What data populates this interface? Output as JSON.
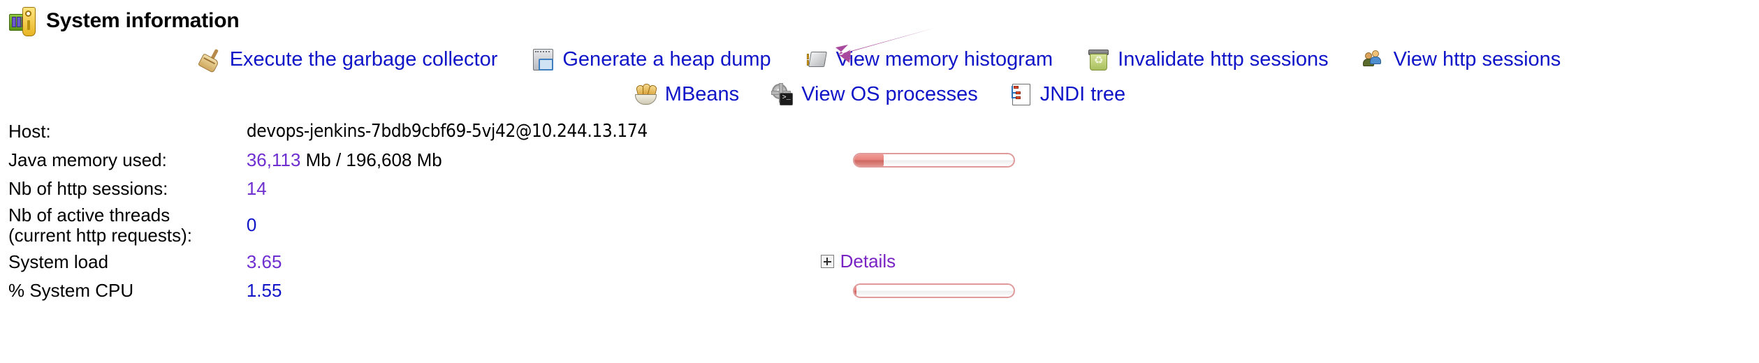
{
  "page": {
    "title": "System information",
    "title_icon": "memory-wrench-icon"
  },
  "actions": {
    "row1": [
      {
        "icon": "broom-icon",
        "label": "Execute the garbage collector"
      },
      {
        "icon": "memory-dump-icon",
        "label": "Generate a heap dump"
      },
      {
        "icon": "memory-chip-icon",
        "label": "View memory histogram"
      },
      {
        "icon": "recycle-bin-icon",
        "label": "Invalidate http sessions"
      },
      {
        "icon": "users-icon",
        "label": "View http sessions"
      }
    ],
    "row2": [
      {
        "icon": "beans-icon",
        "label": "MBeans"
      },
      {
        "icon": "gear-console-icon",
        "label": "View OS processes"
      },
      {
        "icon": "jndi-tree-icon",
        "label": "JNDI tree"
      }
    ]
  },
  "annotation": {
    "type": "arrow",
    "color": "#a9499e",
    "points_to": "Generate a heap dump"
  },
  "info": {
    "host": {
      "label": "Host:",
      "value": "devops-jenkins-7bdb9cbf69-5vj42@10.244.13.174"
    },
    "java_memory": {
      "label": "Java memory used:",
      "used": "36,113",
      "rest": " Mb / 196,608 Mb",
      "bar_percent": 18.4,
      "bar_color": "#e8827c"
    },
    "http_sessions": {
      "label": "Nb of http sessions:",
      "value": "14"
    },
    "active_threads": {
      "label_line1": "Nb of active threads",
      "label_line2": "(current http requests):",
      "value": "0"
    },
    "system_load": {
      "label": "System load",
      "value": "3.65",
      "details_label": "Details",
      "details_icon": "plus-expand-icon"
    },
    "system_cpu": {
      "label": "% System CPU",
      "value": "1.55",
      "bar_percent": 1.55,
      "bar_color": "#e8827c"
    }
  },
  "colors": {
    "link_blue": "#1015c8",
    "value_purple": "#6f2fd0",
    "details_purple": "#7a23c4",
    "arrow_purple": "#a9499e",
    "bar_border": "#e09a9a"
  }
}
